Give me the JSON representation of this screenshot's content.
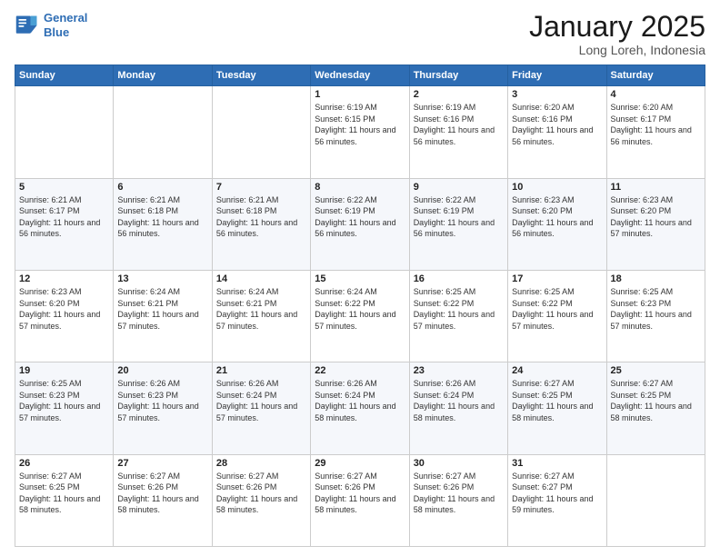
{
  "header": {
    "logo_line1": "General",
    "logo_line2": "Blue",
    "title": "January 2025",
    "subtitle": "Long Loreh, Indonesia"
  },
  "weekdays": [
    "Sunday",
    "Monday",
    "Tuesday",
    "Wednesday",
    "Thursday",
    "Friday",
    "Saturday"
  ],
  "weeks": [
    [
      {
        "day": "",
        "info": ""
      },
      {
        "day": "",
        "info": ""
      },
      {
        "day": "",
        "info": ""
      },
      {
        "day": "1",
        "info": "Sunrise: 6:19 AM\nSunset: 6:15 PM\nDaylight: 11 hours and 56 minutes."
      },
      {
        "day": "2",
        "info": "Sunrise: 6:19 AM\nSunset: 6:16 PM\nDaylight: 11 hours and 56 minutes."
      },
      {
        "day": "3",
        "info": "Sunrise: 6:20 AM\nSunset: 6:16 PM\nDaylight: 11 hours and 56 minutes."
      },
      {
        "day": "4",
        "info": "Sunrise: 6:20 AM\nSunset: 6:17 PM\nDaylight: 11 hours and 56 minutes."
      }
    ],
    [
      {
        "day": "5",
        "info": "Sunrise: 6:21 AM\nSunset: 6:17 PM\nDaylight: 11 hours and 56 minutes."
      },
      {
        "day": "6",
        "info": "Sunrise: 6:21 AM\nSunset: 6:18 PM\nDaylight: 11 hours and 56 minutes."
      },
      {
        "day": "7",
        "info": "Sunrise: 6:21 AM\nSunset: 6:18 PM\nDaylight: 11 hours and 56 minutes."
      },
      {
        "day": "8",
        "info": "Sunrise: 6:22 AM\nSunset: 6:19 PM\nDaylight: 11 hours and 56 minutes."
      },
      {
        "day": "9",
        "info": "Sunrise: 6:22 AM\nSunset: 6:19 PM\nDaylight: 11 hours and 56 minutes."
      },
      {
        "day": "10",
        "info": "Sunrise: 6:23 AM\nSunset: 6:20 PM\nDaylight: 11 hours and 56 minutes."
      },
      {
        "day": "11",
        "info": "Sunrise: 6:23 AM\nSunset: 6:20 PM\nDaylight: 11 hours and 57 minutes."
      }
    ],
    [
      {
        "day": "12",
        "info": "Sunrise: 6:23 AM\nSunset: 6:20 PM\nDaylight: 11 hours and 57 minutes."
      },
      {
        "day": "13",
        "info": "Sunrise: 6:24 AM\nSunset: 6:21 PM\nDaylight: 11 hours and 57 minutes."
      },
      {
        "day": "14",
        "info": "Sunrise: 6:24 AM\nSunset: 6:21 PM\nDaylight: 11 hours and 57 minutes."
      },
      {
        "day": "15",
        "info": "Sunrise: 6:24 AM\nSunset: 6:22 PM\nDaylight: 11 hours and 57 minutes."
      },
      {
        "day": "16",
        "info": "Sunrise: 6:25 AM\nSunset: 6:22 PM\nDaylight: 11 hours and 57 minutes."
      },
      {
        "day": "17",
        "info": "Sunrise: 6:25 AM\nSunset: 6:22 PM\nDaylight: 11 hours and 57 minutes."
      },
      {
        "day": "18",
        "info": "Sunrise: 6:25 AM\nSunset: 6:23 PM\nDaylight: 11 hours and 57 minutes."
      }
    ],
    [
      {
        "day": "19",
        "info": "Sunrise: 6:25 AM\nSunset: 6:23 PM\nDaylight: 11 hours and 57 minutes."
      },
      {
        "day": "20",
        "info": "Sunrise: 6:26 AM\nSunset: 6:23 PM\nDaylight: 11 hours and 57 minutes."
      },
      {
        "day": "21",
        "info": "Sunrise: 6:26 AM\nSunset: 6:24 PM\nDaylight: 11 hours and 57 minutes."
      },
      {
        "day": "22",
        "info": "Sunrise: 6:26 AM\nSunset: 6:24 PM\nDaylight: 11 hours and 58 minutes."
      },
      {
        "day": "23",
        "info": "Sunrise: 6:26 AM\nSunset: 6:24 PM\nDaylight: 11 hours and 58 minutes."
      },
      {
        "day": "24",
        "info": "Sunrise: 6:27 AM\nSunset: 6:25 PM\nDaylight: 11 hours and 58 minutes."
      },
      {
        "day": "25",
        "info": "Sunrise: 6:27 AM\nSunset: 6:25 PM\nDaylight: 11 hours and 58 minutes."
      }
    ],
    [
      {
        "day": "26",
        "info": "Sunrise: 6:27 AM\nSunset: 6:25 PM\nDaylight: 11 hours and 58 minutes."
      },
      {
        "day": "27",
        "info": "Sunrise: 6:27 AM\nSunset: 6:26 PM\nDaylight: 11 hours and 58 minutes."
      },
      {
        "day": "28",
        "info": "Sunrise: 6:27 AM\nSunset: 6:26 PM\nDaylight: 11 hours and 58 minutes."
      },
      {
        "day": "29",
        "info": "Sunrise: 6:27 AM\nSunset: 6:26 PM\nDaylight: 11 hours and 58 minutes."
      },
      {
        "day": "30",
        "info": "Sunrise: 6:27 AM\nSunset: 6:26 PM\nDaylight: 11 hours and 58 minutes."
      },
      {
        "day": "31",
        "info": "Sunrise: 6:27 AM\nSunset: 6:27 PM\nDaylight: 11 hours and 59 minutes."
      },
      {
        "day": "",
        "info": ""
      }
    ]
  ]
}
